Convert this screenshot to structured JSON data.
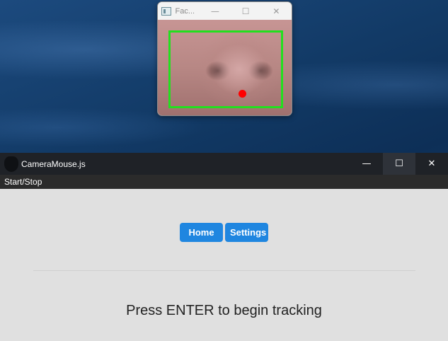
{
  "face_window": {
    "title": "Fac...",
    "controls": {
      "minimize": "—",
      "maximize": "☐",
      "close": "✕"
    }
  },
  "main_window": {
    "title": "CameraMouse.js",
    "controls": {
      "minimize": "—",
      "maximize": "☐",
      "close": "✕"
    },
    "menu": {
      "start_stop": "Start/Stop"
    },
    "nav": {
      "home": "Home",
      "settings": "Settings"
    },
    "status": "Press ENTER to begin tracking"
  },
  "colors": {
    "accent": "#1f86e0",
    "tracking_box": "#22e01e",
    "tracking_point": "#ff0000"
  }
}
